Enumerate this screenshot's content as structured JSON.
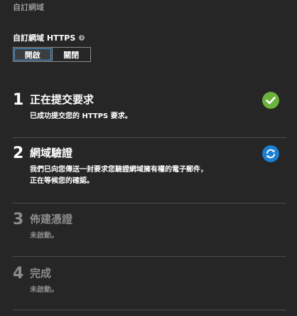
{
  "section": {
    "title": "自訂網域"
  },
  "https": {
    "label": "自訂網域 HTTPS",
    "info_icon": "info-icon",
    "on_label": "開啟",
    "off_label": "關閉",
    "selected": "開啟"
  },
  "steps": [
    {
      "number": "1",
      "title": "正在提交要求",
      "description": "已成功提交您的 HTTPS 要求。",
      "icon": "checkmark-circle-icon",
      "icon_color": "#6bb33a",
      "active": true
    },
    {
      "number": "2",
      "title": "網域驗證",
      "description_line1": "我們已向您傳送一封要求您驗證網域擁有權的電子郵件，",
      "description_line2": "正在等候您的確認。",
      "icon": "sync-circle-icon",
      "icon_color": "#1a7ed1",
      "active": true
    },
    {
      "number": "3",
      "title": "佈建憑證",
      "description": "未啟動。",
      "active": false
    },
    {
      "number": "4",
      "title": "完成",
      "description": "未啟動。",
      "active": false
    }
  ]
}
